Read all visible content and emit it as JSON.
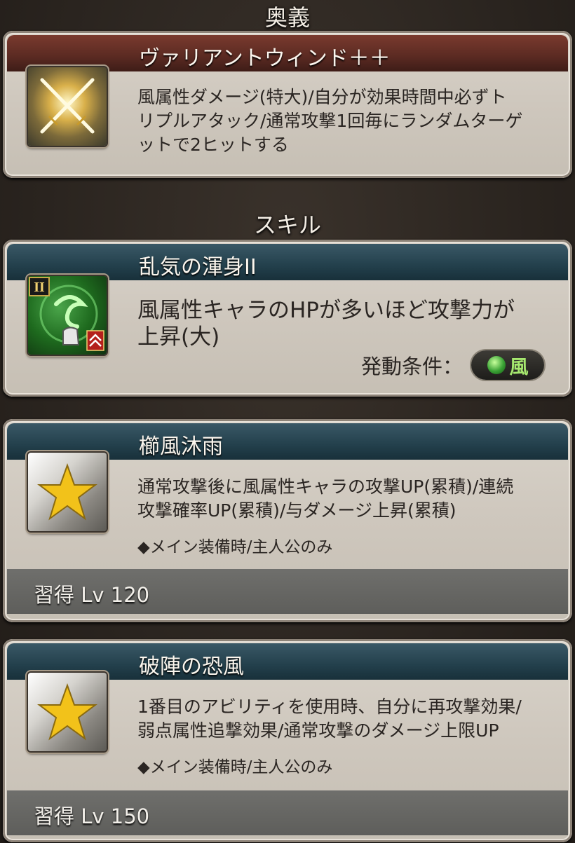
{
  "sections": {
    "ougi_title": "奥義",
    "skill_title": "スキル"
  },
  "ougi": {
    "name": "ヴァリアントウィンド＋＋",
    "desc_line1": "風属性ダメージ(特大)/自分が効果時間中必ずト",
    "desc_line2": "リプルアタック/通常攻撃1回毎にランダムターゲ",
    "desc_line3": "ットで2ヒットする",
    "icon": "crossed-swords-icon"
  },
  "skills": [
    {
      "name": "乱気の渾身II",
      "desc_line1": "風属性キャラのHPが多いほど攻撃力が",
      "desc_line2": "上昇(大)",
      "condition_label": "発動条件：",
      "condition_value": "風",
      "icon": "wind-muscle-skill-icon",
      "badge": "II"
    },
    {
      "name": "櫛風沐雨",
      "desc_line1": "通常攻撃後に風属性キャラの攻撃UP(累積)/連続",
      "desc_line2": "攻撃確率UP(累積)/与ダメージ上昇(累積)",
      "note": "◆メイン装備時/主人公のみ",
      "acquire": "習得 Lv 120",
      "icon": "star-icon"
    },
    {
      "name": "破陣の恐風",
      "desc_line1": "1番目のアビリティを使用時、自分に再攻撃効果/",
      "desc_line2": "弱点属性追撃効果/通常攻撃のダメージ上限UP",
      "note": "◆メイン装備時/主人公のみ",
      "acquire": "習得 Lv 150",
      "icon": "star-icon"
    }
  ],
  "colors": {
    "ougi_header": "#5a2a22",
    "skill_header": "#23404c",
    "wind_green": "#3aa235"
  }
}
